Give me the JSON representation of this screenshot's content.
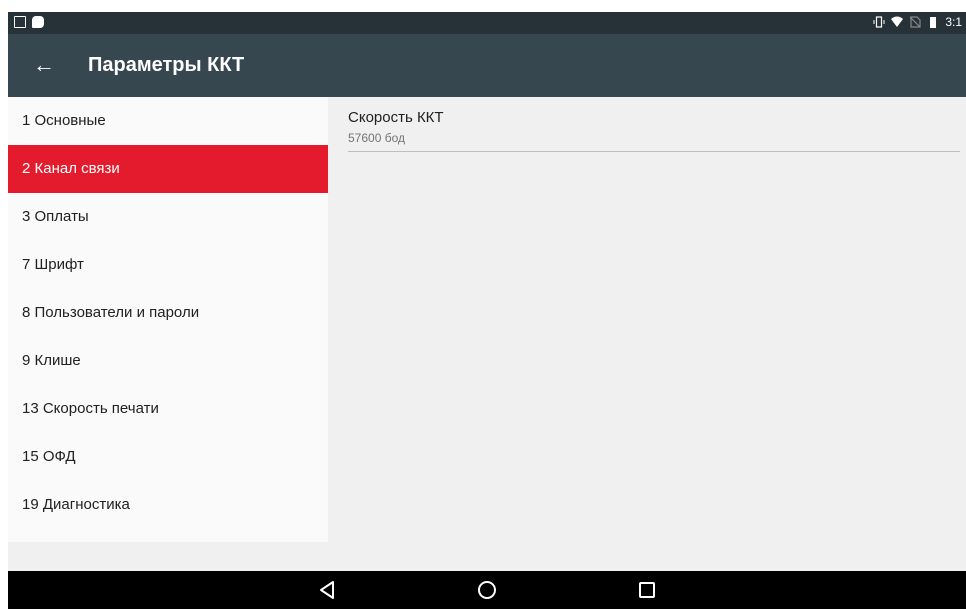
{
  "status_bar": {
    "left_icons": [
      "image-icon",
      "chat-bubble-icon"
    ],
    "right_icons": [
      "vibrate-icon",
      "wifi-icon",
      "no-sim-icon",
      "battery-icon"
    ],
    "time": "3:1"
  },
  "app_bar": {
    "back_icon": "←",
    "title": "Параметры ККТ"
  },
  "sidebar": {
    "items": [
      {
        "label": "1 Основные"
      },
      {
        "label": "2 Канал связи"
      },
      {
        "label": "3 Оплаты"
      },
      {
        "label": "7 Шрифт"
      },
      {
        "label": "8 Пользователи и пароли"
      },
      {
        "label": "9 Клише"
      },
      {
        "label": "13 Скорость печати"
      },
      {
        "label": "15 ОФД"
      },
      {
        "label": "19 Диагностика"
      }
    ],
    "active_index": 1
  },
  "content": {
    "preference": {
      "title": "Скорость ККТ",
      "summary": "57600 бод"
    }
  },
  "nav_bar": {
    "buttons": [
      "back-triangle-icon",
      "home-circle-icon",
      "recents-square-icon"
    ]
  },
  "colors": {
    "status_bar": "#263238",
    "app_bar": "#37474f",
    "active_item": "#e31b2d",
    "nav_bar": "#000000"
  }
}
